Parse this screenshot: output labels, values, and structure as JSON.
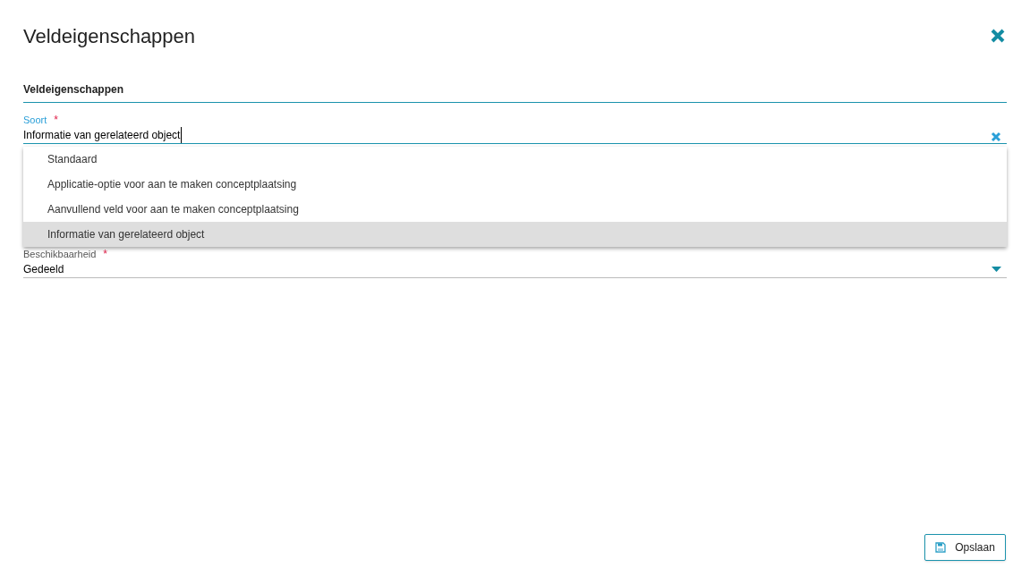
{
  "dialog": {
    "title": "Veldeigenschappen"
  },
  "section": {
    "title": "Veldeigenschappen"
  },
  "fields": [
    {
      "label": "Soort",
      "required_mark": "*",
      "value": "Informatie van gerelateerd object",
      "kind": "combobox",
      "expanded": true,
      "options": [
        {
          "label": "Standaard",
          "selected": false
        },
        {
          "label": "Applicatie-optie voor aan te maken conceptplaatsing",
          "selected": false
        },
        {
          "label": "Aanvullend veld voor aan te maken conceptplaatsing",
          "selected": false
        },
        {
          "label": "Informatie van gerelateerd object",
          "selected": true
        }
      ]
    },
    {
      "label": "Beschikbaarheid",
      "required_mark": "*",
      "value": "Gedeeld",
      "kind": "select",
      "expanded": false
    }
  ],
  "save_button": {
    "label": "Opslaan"
  }
}
